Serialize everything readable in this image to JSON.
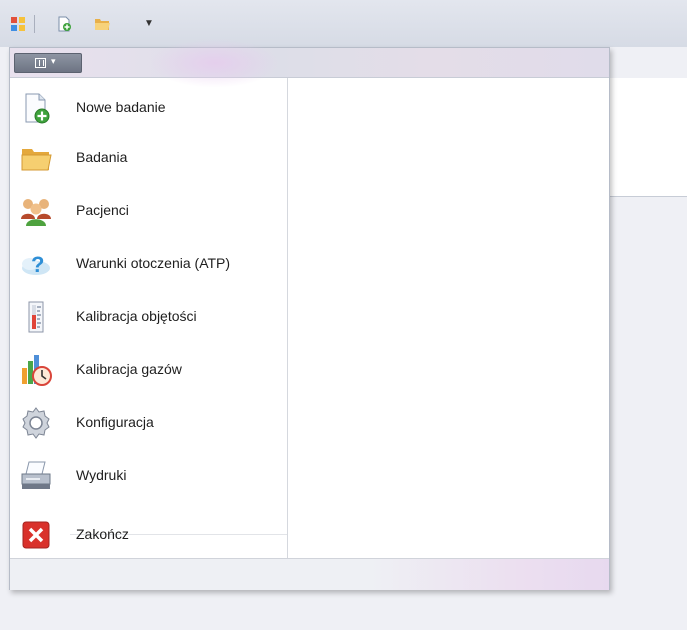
{
  "quick_access": {
    "icons": [
      "app-icon",
      "new-file-icon",
      "open-folder-icon",
      "customize-dropdown-icon"
    ],
    "dropdown_glyph": "▼"
  },
  "file_button": {
    "icon": "file-menu-icon",
    "arrow": "▾"
  },
  "menu": {
    "items": [
      {
        "label": "Nowe badanie",
        "icon": "new-document-icon"
      },
      {
        "label": "Badania",
        "icon": "folder-icon"
      },
      {
        "label": "Pacjenci",
        "icon": "patients-icon"
      },
      {
        "label": "Warunki otoczenia (ATP)",
        "icon": "weather-icon"
      },
      {
        "label": "Kalibracja objętości",
        "icon": "volume-calibration-icon"
      },
      {
        "label": "Kalibracja gazów",
        "icon": "gas-calibration-icon"
      },
      {
        "label": "Konfiguracja",
        "icon": "gear-icon"
      },
      {
        "label": "Wydruki",
        "icon": "printer-icon"
      }
    ],
    "exit": {
      "label": "Zakończ",
      "icon": "close-icon"
    }
  },
  "colors": {
    "exit_red": "#d9312b",
    "folder": "#f0c060",
    "accent_green": "#3ea23c"
  }
}
